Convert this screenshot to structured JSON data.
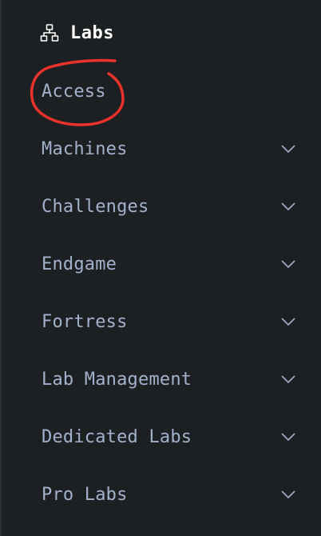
{
  "header": {
    "title": "Labs",
    "icon": "sitemap-icon"
  },
  "menu": {
    "items": [
      {
        "label": "Access",
        "has_chevron": false
      },
      {
        "label": "Machines",
        "has_chevron": true
      },
      {
        "label": "Challenges",
        "has_chevron": true
      },
      {
        "label": "Endgame",
        "has_chevron": true
      },
      {
        "label": "Fortress",
        "has_chevron": true
      },
      {
        "label": "Lab Management",
        "has_chevron": true
      },
      {
        "label": "Dedicated Labs",
        "has_chevron": true
      },
      {
        "label": "Pro Labs",
        "has_chevron": true
      }
    ]
  },
  "colors": {
    "background": "#1c2022",
    "title": "#ffffff",
    "menu_text": "#a4b1cd",
    "chevron": "#a4b1cd",
    "annotation": "#e8322a"
  }
}
